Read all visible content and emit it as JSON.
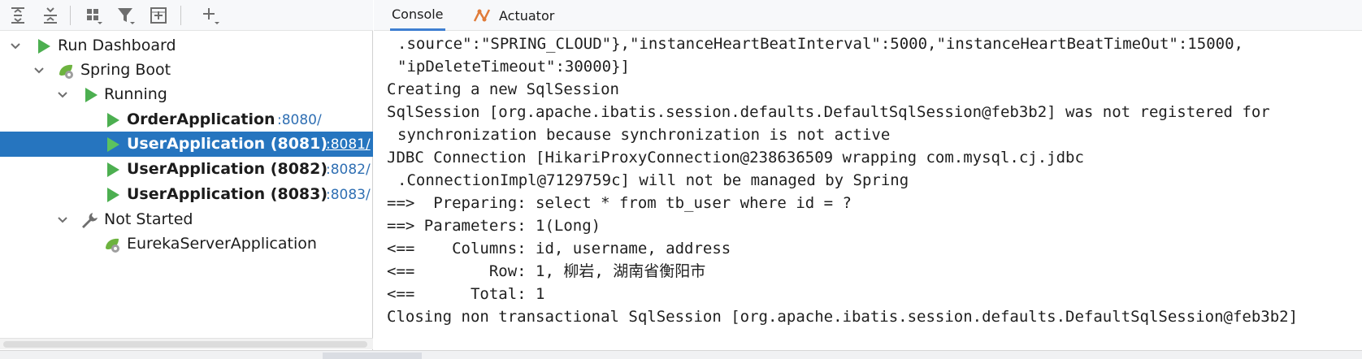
{
  "toolbar": {
    "icons": [
      "expand-all-icon",
      "collapse-all-icon",
      "group-icon",
      "filter-icon",
      "add-config-icon",
      "add-icon"
    ]
  },
  "tree": {
    "run_dashboard": "Run Dashboard",
    "spring_boot": "Spring Boot",
    "running": "Running",
    "order_app": {
      "name": "OrderApplication",
      "port": ":8080/"
    },
    "user_app_8081": {
      "name": "UserApplication (8081)",
      "port": ":8081/"
    },
    "user_app_8082": {
      "name": "UserApplication (8082)",
      "port": ":8082/"
    },
    "user_app_8083": {
      "name": "UserApplication (8083)",
      "port": ":8083/"
    },
    "not_started": "Not Started",
    "eureka_app": "EurekaServerApplication"
  },
  "tabs": {
    "console": "Console",
    "actuator": "Actuator"
  },
  "console": {
    "lines": [
      ".source\":\"SPRING_CLOUD\"},\"instanceHeartBeatInterval\":5000,\"instanceHeartBeatTimeOut\":15000,",
      "\"ipDeleteTimeout\":30000}]",
      "Creating a new SqlSession",
      "SqlSession [org.apache.ibatis.session.defaults.DefaultSqlSession@feb3b2] was not registered for",
      "synchronization because synchronization is not active",
      "JDBC Connection [HikariProxyConnection@238636509 wrapping com.mysql.cj.jdbc",
      ".ConnectionImpl@7129759c] will not be managed by Spring",
      "==>  Preparing: select * from tb_user where id = ?",
      "==> Parameters: 1(Long)",
      "<==    Columns: id, username, address",
      "<==        Row: 1, 柳岩, 湖南省衡阳市",
      "<==      Total: 1",
      "Closing non transactional SqlSession [org.apache.ibatis.session.defaults.DefaultSqlSession@feb3b2]"
    ]
  },
  "colors": {
    "selection": "#2675bf",
    "run_green": "#4caf50",
    "port_link": "#2f6fb3"
  }
}
